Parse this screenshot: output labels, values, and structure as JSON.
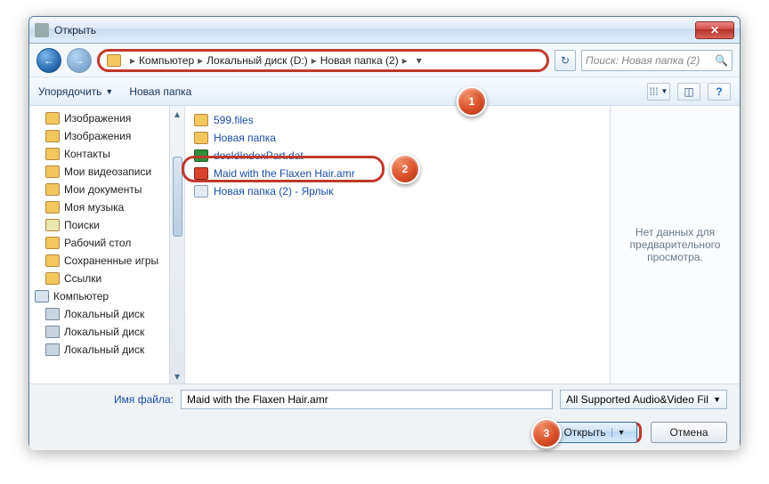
{
  "window": {
    "title": "Открыть"
  },
  "nav": {
    "crumbs": [
      "Компьютер",
      "Локальный диск (D:)",
      "Новая папка (2)"
    ],
    "search_placeholder": "Поиск: Новая папка (2)"
  },
  "toolbar": {
    "organize": "Упорядочить",
    "newfolder": "Новая папка"
  },
  "tree": {
    "items": [
      {
        "label": "Изображения",
        "icon": "folder",
        "indent": 0
      },
      {
        "label": "Изображения",
        "icon": "folder",
        "indent": 0
      },
      {
        "label": "Контакты",
        "icon": "folder",
        "indent": 0
      },
      {
        "label": "Мои видеозаписи",
        "icon": "folder",
        "indent": 0
      },
      {
        "label": "Мои документы",
        "icon": "folder",
        "indent": 0
      },
      {
        "label": "Моя музыка",
        "icon": "folder",
        "indent": 0
      },
      {
        "label": "Поиски",
        "icon": "search",
        "indent": 0
      },
      {
        "label": "Рабочий стол",
        "icon": "folder",
        "indent": 0
      },
      {
        "label": "Сохраненные игры",
        "icon": "folder",
        "indent": 0
      },
      {
        "label": "Ссылки",
        "icon": "folder",
        "indent": 0
      },
      {
        "label": "Компьютер",
        "icon": "comp",
        "indent": -1
      },
      {
        "label": "Локальный диск",
        "icon": "disk",
        "indent": 0
      },
      {
        "label": "Локальный диск",
        "icon": "disk",
        "indent": 0
      },
      {
        "label": "Локальный диск",
        "icon": "disk",
        "indent": 0
      }
    ]
  },
  "files": {
    "items": [
      {
        "label": "599.files",
        "icon": "folder"
      },
      {
        "label": "Новая папка",
        "icon": "folder"
      },
      {
        "label": "docIdIndexPart.dat",
        "icon": "dat"
      },
      {
        "label": "Maid with the Flaxen Hair.amr",
        "icon": "amr",
        "selected": true
      },
      {
        "label": "Новая папка (2) - Ярлык",
        "icon": "lnk"
      }
    ]
  },
  "preview": {
    "empty_text": "Нет данных для предварительного просмотра."
  },
  "bottom": {
    "filename_label": "Имя файла:",
    "filename_value": "Maid with the Flaxen Hair.amr",
    "filter_value": "All Supported Audio&Video Fil",
    "open_label": "Открыть",
    "cancel_label": "Отмена"
  },
  "badges": {
    "b1": "1",
    "b2": "2",
    "b3": "3"
  }
}
